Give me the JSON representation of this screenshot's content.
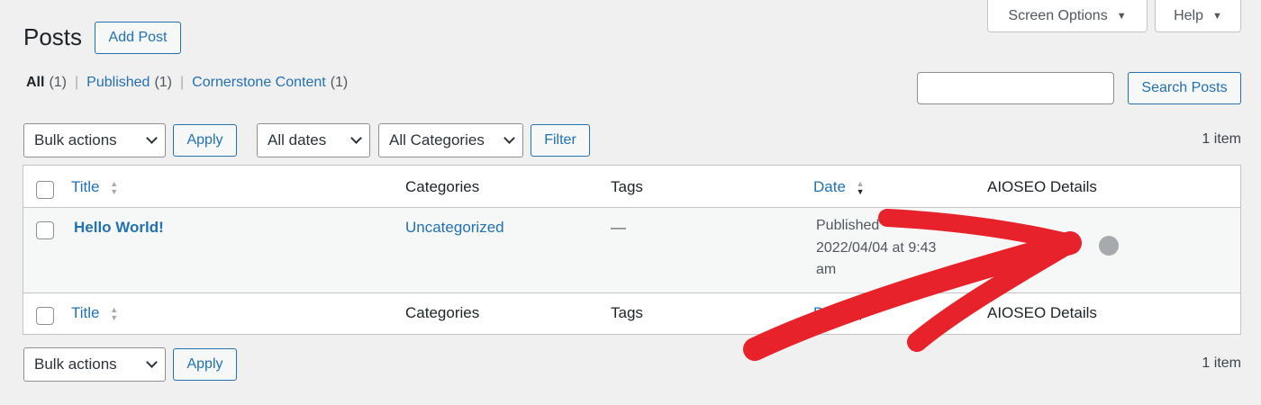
{
  "header": {
    "title": "Posts",
    "add_new_label": "Add Post",
    "screen_options_label": "Screen Options",
    "help_label": "Help"
  },
  "filters": {
    "all_label": "All",
    "all_count": "(1)",
    "published_label": "Published",
    "published_count": "(1)",
    "cornerstone_label": "Cornerstone Content",
    "cornerstone_count": "(1)",
    "separator": "|"
  },
  "search": {
    "placeholder": "",
    "button_label": "Search Posts"
  },
  "tablenav_top": {
    "bulk_actions_label": "Bulk actions",
    "apply_label": "Apply",
    "dates_label": "All dates",
    "categories_label": "All Categories",
    "filter_label": "Filter",
    "item_count": "1 item"
  },
  "table": {
    "columns": {
      "title": "Title",
      "categories": "Categories",
      "tags": "Tags",
      "date": "Date",
      "aioseo": "AIOSEO Details"
    },
    "rows": [
      {
        "title": "Hello World!",
        "category": "Uncategorized",
        "tags": "—",
        "date_status": "Published",
        "date_line1": "2022/04/04 at 9:43",
        "date_line2": "am"
      }
    ]
  },
  "tablenav_bottom": {
    "bulk_actions_label": "Bulk actions",
    "apply_label": "Apply",
    "item_count": "1 item"
  },
  "colors": {
    "accent": "#2271b1",
    "background": "#f0f0f1",
    "annotation_arrow": "#e8222b",
    "seo_status_dot": "#a7aaad"
  }
}
